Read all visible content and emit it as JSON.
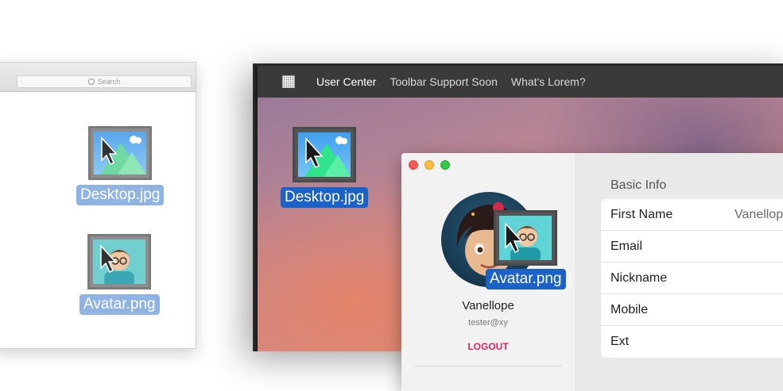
{
  "finder": {
    "search_placeholder": "Search",
    "files": [
      {
        "name": "Desktop.jpg"
      },
      {
        "name": "Avatar.png"
      }
    ]
  },
  "app": {
    "toolbar": {
      "logo_icon": "qr-logo-icon",
      "items": [
        "User Center",
        "Toolbar Support Soon",
        "What's Lorem?"
      ]
    },
    "desktop_file": {
      "name": "Desktop.jpg"
    },
    "dragged_file": {
      "name": "Avatar.png"
    },
    "profile": {
      "name": "Vanellope",
      "email": "tester@xy",
      "logout_label": "LOGOUT"
    },
    "basic_info": {
      "title": "Basic Info",
      "fields": [
        {
          "label": "First Name",
          "value": "Vanellope"
        },
        {
          "label": "Email",
          "value": ""
        },
        {
          "label": "Nickname",
          "value": ""
        },
        {
          "label": "Mobile",
          "value": ""
        },
        {
          "label": "Ext",
          "value": ""
        }
      ]
    }
  },
  "colors": {
    "selection_light": "#8fb3e3",
    "selection_strong": "#1a61c8",
    "logout": "#e0245e",
    "toolbar": "#3a3a3a"
  }
}
